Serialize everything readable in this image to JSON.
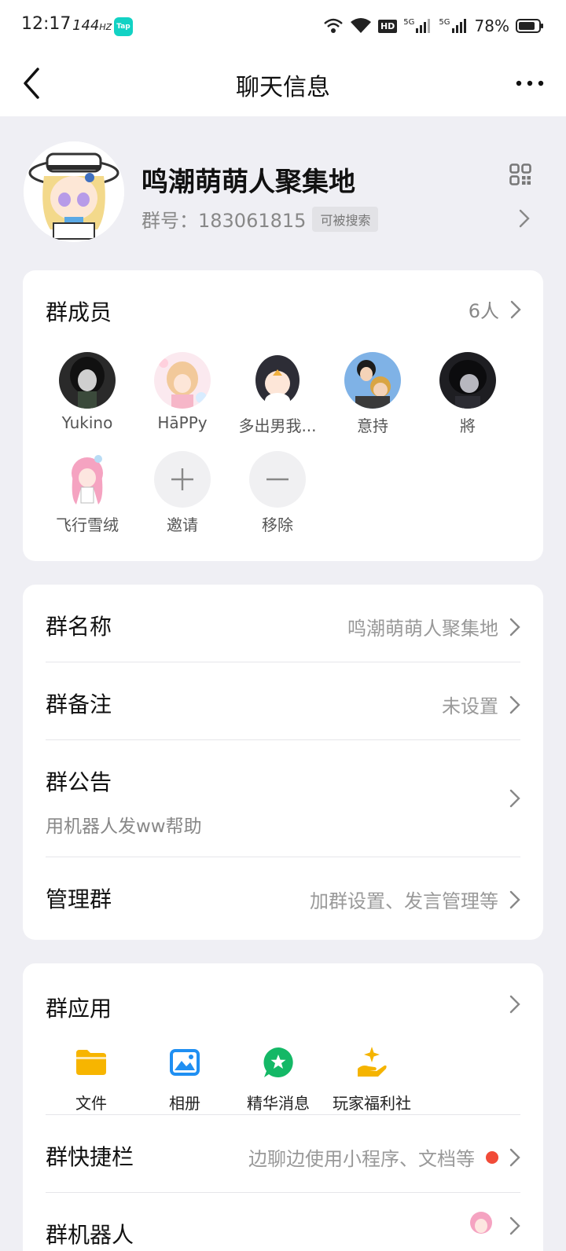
{
  "status": {
    "time": "12:17",
    "refresh": "144",
    "refresh_unit": "HZ",
    "app_badge": "Tap",
    "net_a": "5G",
    "net_b": "5G",
    "hd_badge": "HD",
    "battery": "78%"
  },
  "header": {
    "title": "聊天信息"
  },
  "group": {
    "name": "鸣潮萌萌人聚集地",
    "id_label": "群号：",
    "id_value": "183061815",
    "searchable_tag": "可被搜索"
  },
  "members": {
    "title": "群成员",
    "count": "6人",
    "list": [
      {
        "name": "Yukino",
        "avatar": "dark-hair-girl"
      },
      {
        "name": "ΗāPPy",
        "avatar": "blonde-girl-pastel"
      },
      {
        "name": "多出男我...",
        "avatar": "penguin-hood-girl"
      },
      {
        "name": "意持",
        "avatar": "anime-men"
      },
      {
        "name": "將",
        "avatar": "dark-hair-boy"
      },
      {
        "name": "飞行雪绒",
        "avatar": "pink-hair-girl"
      }
    ],
    "invite_label": "邀请",
    "remove_label": "移除"
  },
  "settings": {
    "name_label": "群名称",
    "name_value": "鸣潮萌萌人聚集地",
    "remark_label": "群备注",
    "remark_value": "未设置",
    "notice_label": "群公告",
    "notice_value": "用机器人发ww帮助",
    "manage_label": "管理群",
    "manage_value": "加群设置、发言管理等"
  },
  "apps": {
    "title": "群应用",
    "items": [
      {
        "label": "文件",
        "icon": "folder-icon",
        "color": "#f7b500"
      },
      {
        "label": "相册",
        "icon": "photo-icon",
        "color": "#1f8ff2"
      },
      {
        "label": "精华消息",
        "icon": "star-chat-icon",
        "color": "#14b866"
      },
      {
        "label": "玩家福利社",
        "icon": "gift-hand-icon",
        "color": "#f5b400"
      }
    ],
    "shortcut_label": "群快捷栏",
    "shortcut_value": "边聊边使用小程序、文档等",
    "robot_label": "群机器人"
  },
  "colors": {
    "background": "#efeff4",
    "card": "#ffffff",
    "accent_red": "#f14b38"
  }
}
